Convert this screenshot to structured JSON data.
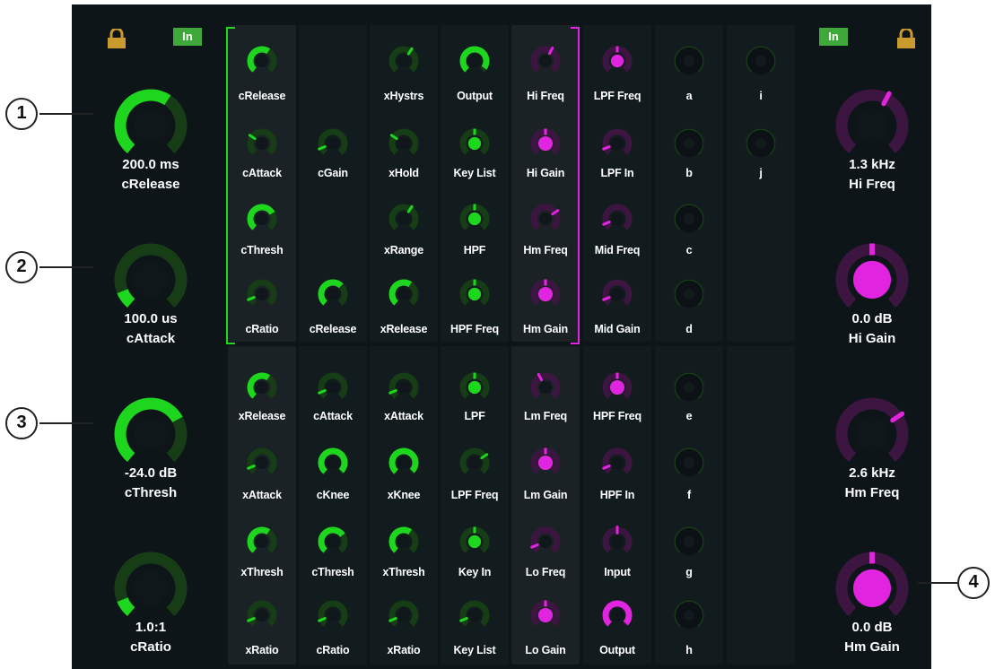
{
  "colors": {
    "green": "#1fd61f",
    "green_dim": "#163d16",
    "magenta": "#e024e0",
    "magenta_dim": "#3c1640",
    "badge": "#3fa83a",
    "lock": "#c99a2e"
  },
  "left_badge": "In",
  "right_badge": "In",
  "callouts": [
    "1",
    "2",
    "3",
    "4"
  ],
  "side_left": [
    {
      "value": "200.0 ms",
      "label": "cRelease",
      "level": 0.62,
      "color": "green"
    },
    {
      "value": "100.0 us",
      "label": "cAttack",
      "level": 0.1,
      "color": "green"
    },
    {
      "value": "-24.0 dB",
      "label": "cThresh",
      "level": 0.72,
      "color": "green"
    },
    {
      "value": "1.0:1",
      "label": "cRatio",
      "level": 0.1,
      "color": "green"
    }
  ],
  "side_right": [
    {
      "value": "1.3 kHz",
      "label": "Hi Freq",
      "level": 0.6,
      "color": "magenta",
      "type": "ring"
    },
    {
      "value": "0.0 dB",
      "label": "Hi Gain",
      "level": 0.5,
      "color": "magenta",
      "type": "fill"
    },
    {
      "value": "2.6 kHz",
      "label": "Hm Freq",
      "level": 0.7,
      "color": "magenta",
      "type": "ring"
    },
    {
      "value": "0.0 dB",
      "label": "Hm Gain",
      "level": 0.5,
      "color": "magenta",
      "type": "fill"
    }
  ],
  "grid": [
    [
      "cRelease",
      "",
      "xHystrs",
      "Output",
      "Hi Freq",
      "LPF Freq",
      "a",
      "i"
    ],
    [
      "cAttack",
      "cGain",
      "xHold",
      "Key List",
      "Hi Gain",
      "LPF In",
      "b",
      "j"
    ],
    [
      "cThresh",
      "",
      "xRange",
      "HPF",
      "Hm Freq",
      "Mid Freq",
      "c",
      ""
    ],
    [
      "cRatio",
      "cRelease",
      "xRelease",
      "HPF Freq",
      "Hm Gain",
      "Mid Gain",
      "d",
      ""
    ],
    [
      "xRelease",
      "cAttack",
      "xAttack",
      "LPF",
      "Lm Freq",
      "HPF Freq",
      "e",
      ""
    ],
    [
      "xAttack",
      "cKnee",
      "xKnee",
      "LPF Freq",
      "Lm Gain",
      "HPF In",
      "f",
      ""
    ],
    [
      "xThresh",
      "cThresh",
      "xThresh",
      "Key In",
      "Lo Freq",
      "Input",
      "g",
      ""
    ],
    [
      "xRatio",
      "cRatio",
      "xRatio",
      "Key List",
      "Lo Gain",
      "Output",
      "h",
      ""
    ]
  ]
}
